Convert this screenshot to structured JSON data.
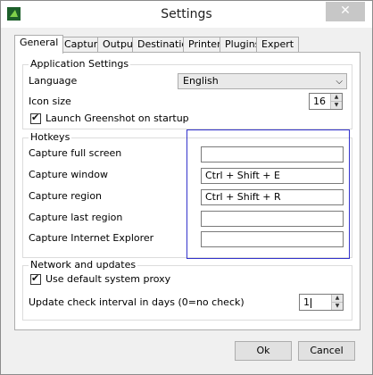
{
  "window": {
    "title": "Settings",
    "close_glyph": "✕"
  },
  "tabs": [
    "General",
    "Capture",
    "Output",
    "Destination",
    "Printer",
    "Plugins",
    "Expert"
  ],
  "application_settings": {
    "title": "Application Settings",
    "language_label": "Language",
    "language_value": "English",
    "icon_size_label": "Icon size",
    "icon_size_value": "16",
    "launch_label": "Launch Greenshot on startup",
    "launch_checked": true
  },
  "hotkeys": {
    "title": "Hotkeys",
    "items": [
      {
        "label": "Capture full screen",
        "value": ""
      },
      {
        "label": "Capture window",
        "value": "Ctrl + Shift + E"
      },
      {
        "label": "Capture region",
        "value": "Ctrl + Shift + R"
      },
      {
        "label": "Capture last region",
        "value": ""
      },
      {
        "label": "Capture Internet Explorer",
        "value": ""
      }
    ]
  },
  "network": {
    "title": "Network and updates",
    "proxy_label": "Use default system proxy",
    "proxy_checked": true,
    "update_label": "Update check interval in days (0=no check)",
    "update_value": "1"
  },
  "buttons": {
    "ok": "Ok",
    "cancel": "Cancel"
  },
  "colors": {
    "highlight_border": "#3333cc",
    "title_close_bg": "#c7c7c7"
  },
  "icons": {
    "app": "greenshot-icon",
    "dropdown": "chevron-down-icon",
    "spin": "spin-arrows-icon"
  }
}
